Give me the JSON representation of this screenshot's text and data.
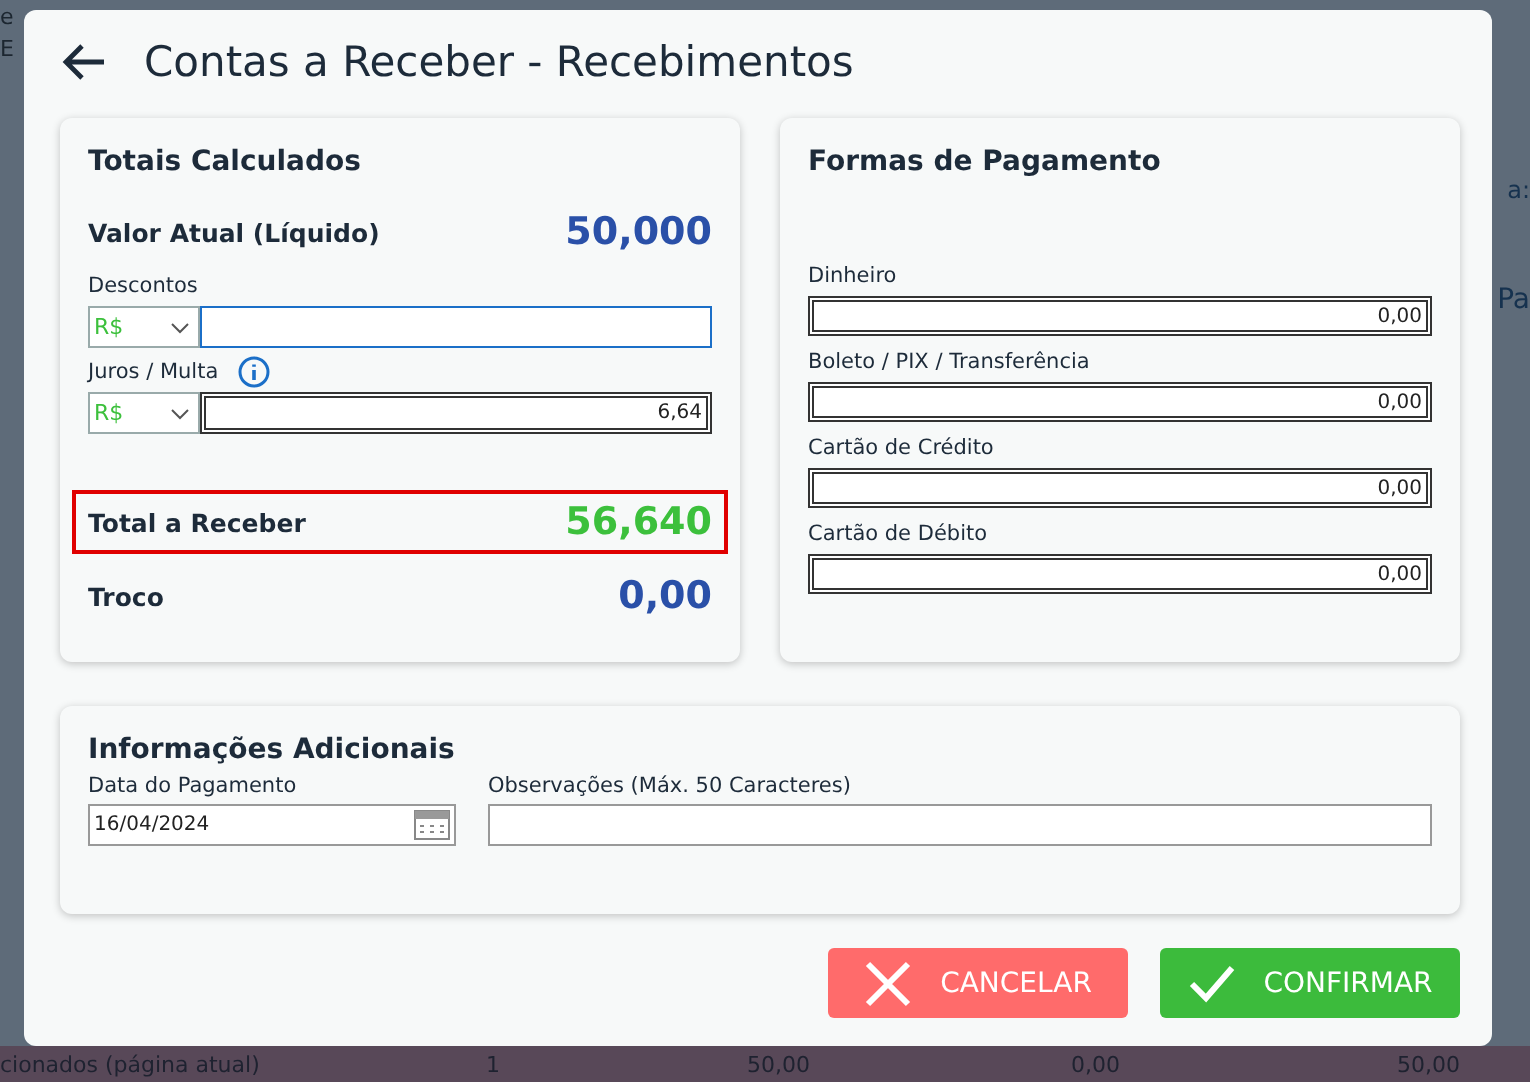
{
  "background": {
    "fragments_top": [
      "e",
      "E"
    ],
    "right_label": "a:",
    "right_heading": "Pa",
    "footer": [
      "cionados (página atual)",
      "1",
      "50,00",
      "0,00",
      "50,00"
    ]
  },
  "dialog": {
    "title": "Contas a Receber - Recebimentos",
    "totals": {
      "title": "Totais Calculados",
      "current_label": "Valor Atual (Líquido)",
      "current_value": "50,000",
      "discount": {
        "label": "Descontos",
        "currency": "R$"
      },
      "interest": {
        "label": "Juros / Multa",
        "currency": "R$",
        "value": "6,64"
      },
      "total_label": "Total a Receber",
      "total_value": "56,640",
      "change_label": "Troco",
      "change_value": "0,00"
    },
    "payments": {
      "title": "Formas de Pagamento",
      "methods": [
        {
          "label": "Dinheiro",
          "value": "0,00"
        },
        {
          "label": "Boleto / PIX / Transferência",
          "value": "0,00"
        },
        {
          "label": "Cartão de Crédito",
          "value": "0,00"
        },
        {
          "label": "Cartão de Débito",
          "value": "0,00"
        }
      ]
    },
    "additional": {
      "title": "Informações Adicionais",
      "date_label": "Data do Pagamento",
      "date_value": "16/04/2024",
      "notes_label": "Observações (Máx. 50 Caracteres)"
    },
    "buttons": [
      {
        "kind": "cancel",
        "label": "CANCELAR"
      },
      {
        "kind": "confirm",
        "label": "CONFIRMAR"
      }
    ]
  }
}
